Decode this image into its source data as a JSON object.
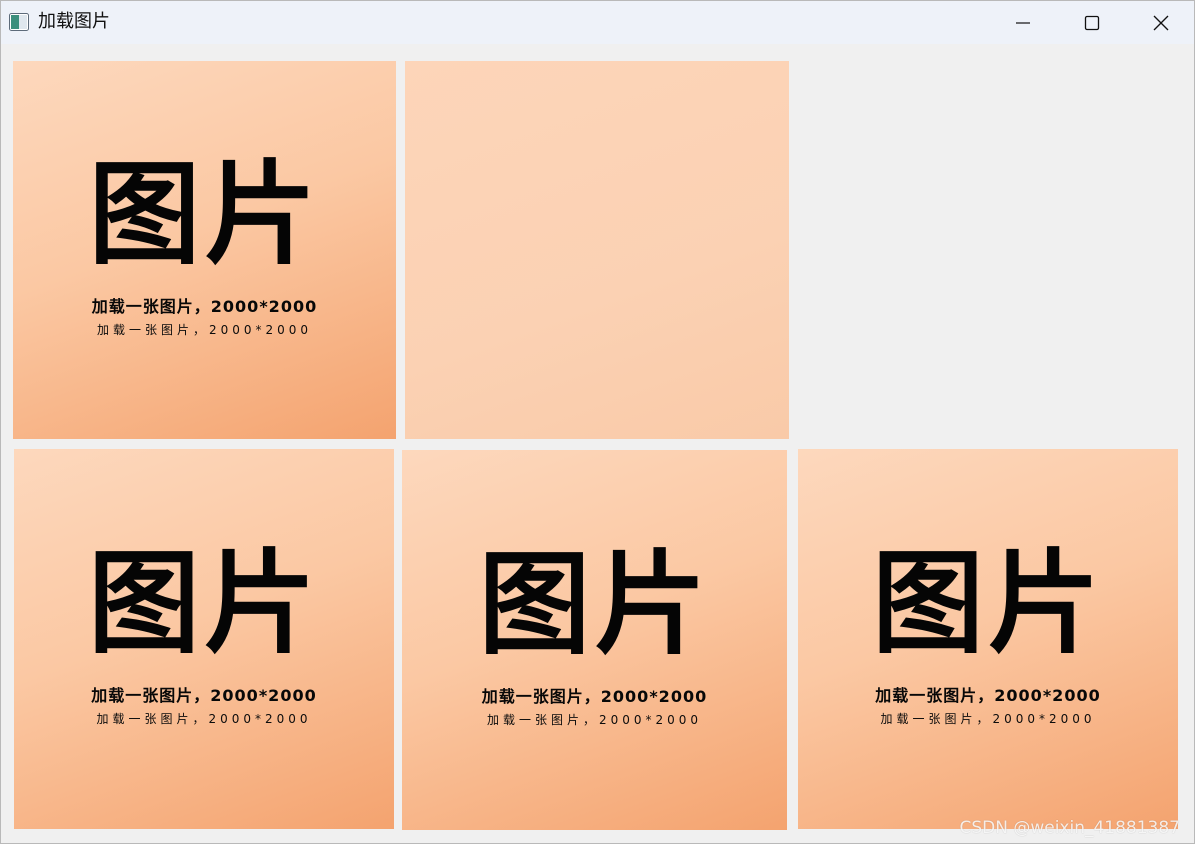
{
  "window": {
    "title": "加载图片",
    "icon": "app-window-icon"
  },
  "controls": {
    "minimize_icon": "minimize-icon",
    "maximize_icon": "maximize-icon",
    "close_icon": "close-icon"
  },
  "tiles": [
    {
      "big": "图片",
      "sub1": "加载一张图片，2000*2000",
      "sub2": "加载一张图片，2000*2000"
    },
    {
      "big": "",
      "sub1": "",
      "sub2": ""
    },
    {
      "big": "图片",
      "sub1": "加载一张图片，2000*2000",
      "sub2": "加载一张图片，2000*2000"
    },
    {
      "big": "图片",
      "sub1": "加载一张图片，2000*2000",
      "sub2": "加载一张图片，2000*2000"
    },
    {
      "big": "图片",
      "sub1": "加载一张图片，2000*2000",
      "sub2": "加载一张图片，2000*2000"
    }
  ],
  "watermark": "CSDN @weixin_41881387",
  "colors": {
    "tile_light": "#fdd8bd",
    "tile_dark": "#f4a36f",
    "titlebar": "#eef2f9",
    "background": "#f0f0f0"
  }
}
